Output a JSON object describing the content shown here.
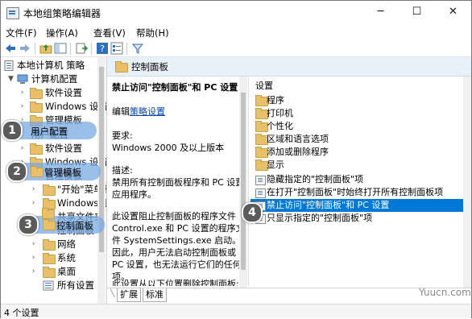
{
  "window": {
    "title": "本地组策略编辑器",
    "minimize": "─",
    "maximize": "☐",
    "close": "✕"
  },
  "menu": [
    "文件(F)",
    "操作(A)",
    "查看(V)",
    "帮助(H)"
  ],
  "tree": {
    "root": "本地计算机 策略",
    "computer": "计算机配置",
    "c_software": "软件设置",
    "c_windows": "Windows 设置",
    "c_admin": "管理模板",
    "user": "用户配置",
    "u_software": "软件设置",
    "u_windows": "Windows 设置",
    "u_admin": "管理模板",
    "start": "\"开始\"菜单和",
    "wincomp": "Windows 组",
    "shared": "共享文件夹",
    "control": "控制面板",
    "network": "网络",
    "system": "系统",
    "desktop": "桌面",
    "all": "所有设置"
  },
  "header": {
    "title": "控制面板"
  },
  "description": {
    "title": "禁止访问\"控制面板\"和 PC 设置",
    "edit_prefix": "编辑",
    "edit_link": "策略设置",
    "req_label": "要求:",
    "req_value": "Windows 2000 及以上版本",
    "desc_label": "描述:",
    "desc_text": "禁用所有控制面板程序和 PC 设置应用程序。",
    "para2": "此设置阻止控制面板的程序文件 Control.exe 和 PC 设置的程序文件 SystemSettings.exe 启动。因此，用户无法启动控制面板或 PC 设置，也无法运行它们的任何项。",
    "para3": "此设置从以下位置删除控制面板:"
  },
  "list": {
    "header": "设置",
    "items": [
      {
        "label": "程序",
        "kind": "folder"
      },
      {
        "label": "打印机",
        "kind": "folder"
      },
      {
        "label": "个性化",
        "kind": "folder"
      },
      {
        "label": "区域和语言选项",
        "kind": "folder"
      },
      {
        "label": "添加或删除程序",
        "kind": "folder"
      },
      {
        "label": "显示",
        "kind": "folder"
      },
      {
        "label": "隐藏指定的\"控制面板\"项",
        "kind": "policy"
      },
      {
        "label": "在打开\"控制面板\"时始终打开所有控制面板项",
        "kind": "policy"
      },
      {
        "label": "禁止访问\"控制面板\"和 PC 设置",
        "kind": "policy",
        "selected": true
      },
      {
        "label": "只显示指定的\"控制面板\"项",
        "kind": "policy"
      }
    ]
  },
  "tabs": [
    "扩展",
    "标准"
  ],
  "status": "4 个设置",
  "callouts": {
    "one": "1",
    "two": "2",
    "three": "3",
    "four": "4"
  },
  "watermark": "Yuucn.com",
  "colors": {
    "selection": "#0078d7",
    "callout": "#78aae1",
    "badge": "#5b5b5b",
    "header_bg": "#e8f0f8"
  }
}
